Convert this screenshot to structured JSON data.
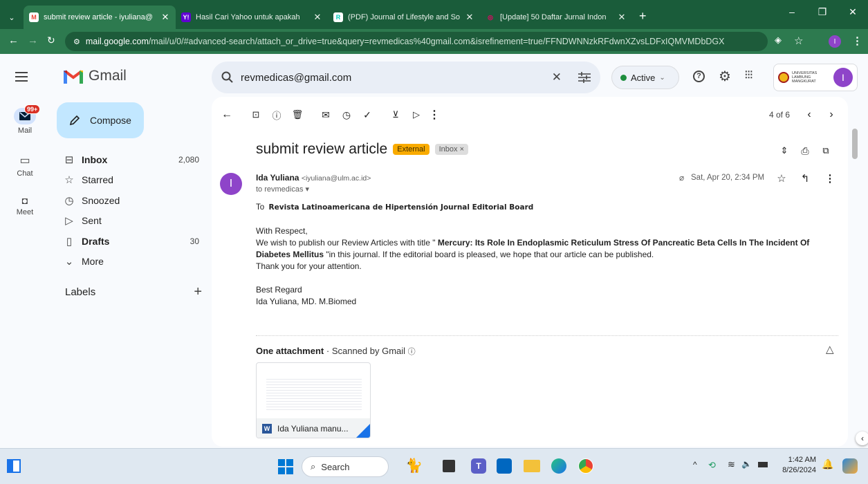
{
  "browser": {
    "tabs": [
      {
        "title": "submit review article - iyuliana@",
        "favicon": "gmail-icon",
        "active": true
      },
      {
        "title": "Hasil Cari Yahoo untuk apakah",
        "favicon": "yahoo-icon",
        "active": false
      },
      {
        "title": "(PDF) Journal of Lifestyle and So",
        "favicon": "researchgate-icon",
        "active": false
      },
      {
        "title": "[Update] 50 Daftar Jurnal Indon",
        "favicon": "site-icon",
        "active": false
      }
    ],
    "new_tab_symbol": "+",
    "url_host": "mail.google.com",
    "url_rest": "/mail/u/0/#advanced-search/attach_or_drive=true&query=revmedicas%40gmail.com&isrefinement=true/FFNDWNNzkRFdwnXZvsLDFxIQMVMDbDGX",
    "profile_initial": "I"
  },
  "gmail": {
    "logo_text": "Gmail",
    "compose_label": "Compose",
    "rail": {
      "mail": "Mail",
      "mail_badge": "99+",
      "chat": "Chat",
      "meet": "Meet"
    },
    "nav": [
      {
        "label": "Inbox",
        "count": "2,080",
        "bold": true,
        "icon": "inbox-icon"
      },
      {
        "label": "Starred",
        "count": "",
        "bold": false,
        "icon": "star-icon"
      },
      {
        "label": "Snoozed",
        "count": "",
        "bold": false,
        "icon": "clock-icon"
      },
      {
        "label": "Sent",
        "count": "",
        "bold": false,
        "icon": "send-icon"
      },
      {
        "label": "Drafts",
        "count": "30",
        "bold": true,
        "icon": "draft-icon"
      },
      {
        "label": "More",
        "count": "",
        "bold": false,
        "icon": "chevron-down-icon"
      }
    ],
    "labels_heading": "Labels",
    "search_value": "revmedicas@gmail.com",
    "status": "Active",
    "org_text": "UNIVERSITAS LAMBUNG MANGKURAT",
    "avatar_initial": "I",
    "pager": "4 of 6"
  },
  "email": {
    "subject": "submit review article",
    "tag_external": "External",
    "tag_inbox": "Inbox",
    "sender_name": "Ida Yuliana",
    "sender_email": "<iyuliana@ulm.ac.id>",
    "recipient": "to revmedicas",
    "date": "Sat, Apr 20, 2:34 PM",
    "avatar_initial": "I",
    "to_prefix": "To",
    "to_line": "Revista Latinoamericana de Hipertensión Journal Editorial Board",
    "greeting": "With Respect,",
    "body_pre": "We wish to publish our Review  Articles with title \"",
    "body_title": "Mercury: Its Role In Endoplasmic Reticulum Stress Of Pancreatic Beta Cells In The Incident Of Diabetes Mellitus",
    "body_post": "\"in this journal. If the editorial board is pleased, we hope that our article can be published.",
    "thanks": "Thank you for your attention.",
    "closing": "Best Regard",
    "signature": "Ida Yuliana, MD. M.Biomed",
    "attachment_heading": "One attachment",
    "attachment_scan": "Scanned by Gmail",
    "attachment_name": "Ida Yuliana manu...",
    "attachment_type": "W"
  },
  "taskbar": {
    "search_label": "Search",
    "time": "1:42 AM",
    "date": "8/26/2024"
  },
  "colors": {
    "browser_bg": "#2d7a4f",
    "compose_bg": "#c2e7ff",
    "external_tag": "#f9ab00",
    "active_dot": "#1e8e3e",
    "avatar": "#8e44c9"
  }
}
